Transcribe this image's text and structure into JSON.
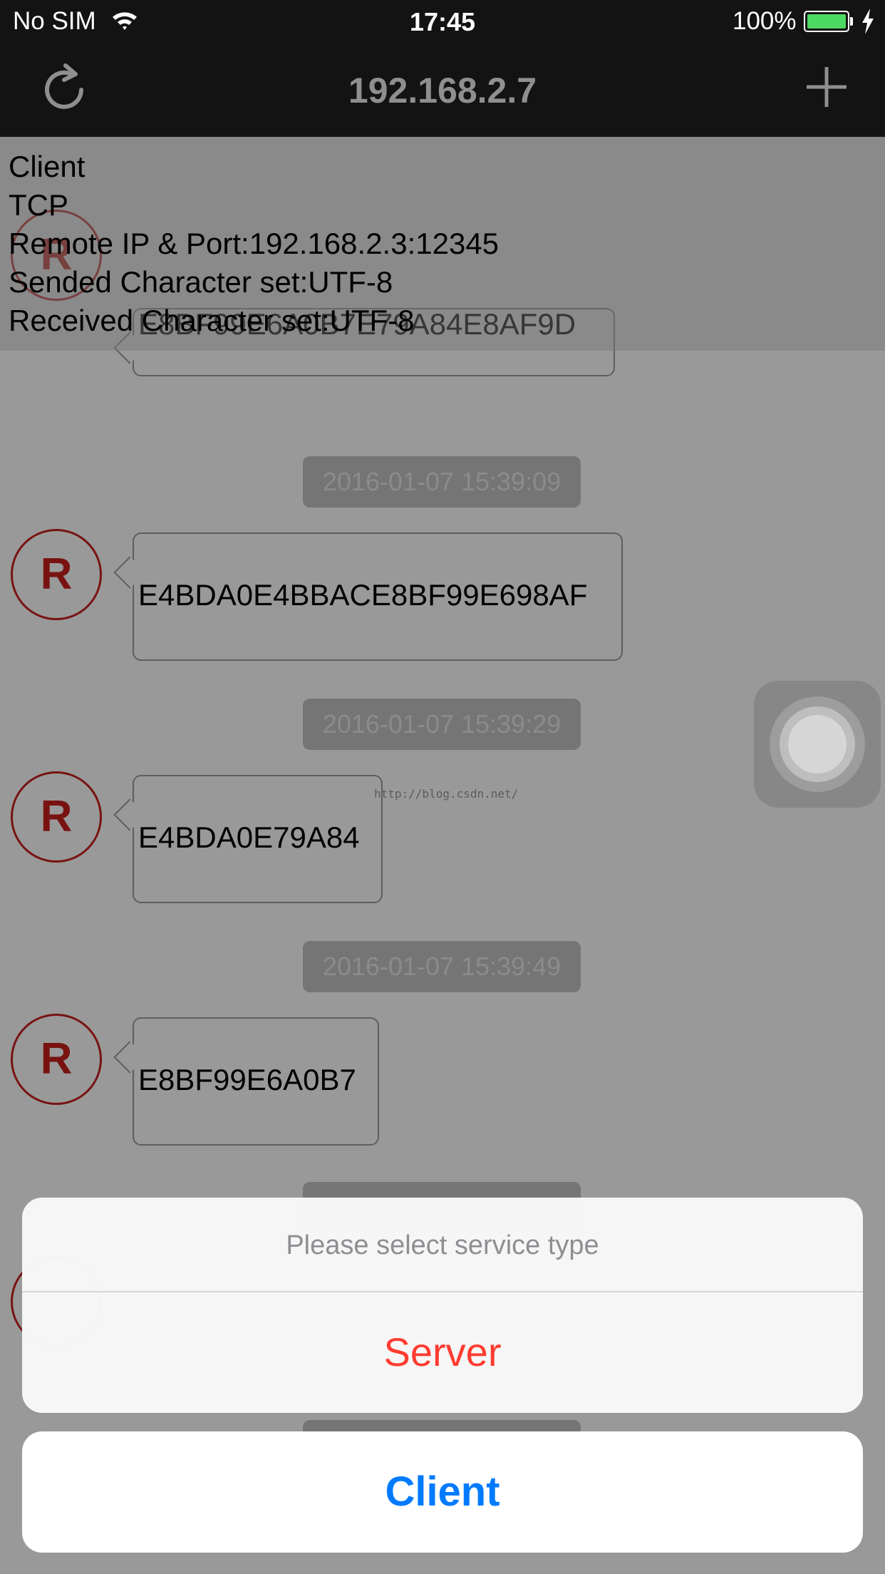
{
  "status_bar": {
    "carrier": "No SIM",
    "time": "17:45",
    "battery_percent": "100%",
    "wifi_icon": "wifi-icon",
    "battery_icon": "battery-icon",
    "charging_icon": "bolt-icon",
    "battery_color": "#4cd964"
  },
  "navbar": {
    "title": "192.168.2.7",
    "left_icon": "refresh-icon",
    "right_icon": "plus-icon"
  },
  "connection_info": {
    "line1": "Client",
    "line2": "TCP",
    "line3": "Remote IP & Port:192.168.2.3:12345",
    "line4": "Sended Character set:UTF-8",
    "line5": "Received Character set:UTF-8"
  },
  "messages": [
    {
      "avatar": "R",
      "text": "E8BF99E6A0B7E79A84E8AF9D"
    },
    {
      "timestamp": "2016-01-07 15:39:09",
      "avatar": "R",
      "text": "E4BDA0E4BBACE8BF99E698AF"
    },
    {
      "timestamp": "2016-01-07 15:39:29",
      "avatar": "R",
      "text": "E4BDA0E79A84"
    },
    {
      "timestamp": "2016-01-07 15:39:49",
      "avatar": "R",
      "text": "E8BF99E6A0B7"
    }
  ],
  "watermark": "http://blog.csdn.net/",
  "action_sheet": {
    "message": "Please select service type",
    "option_server": "Server",
    "option_client": "Client"
  },
  "colors": {
    "avatar": "#c9201e",
    "destructive": "#ff3b30",
    "action": "#007aff"
  }
}
